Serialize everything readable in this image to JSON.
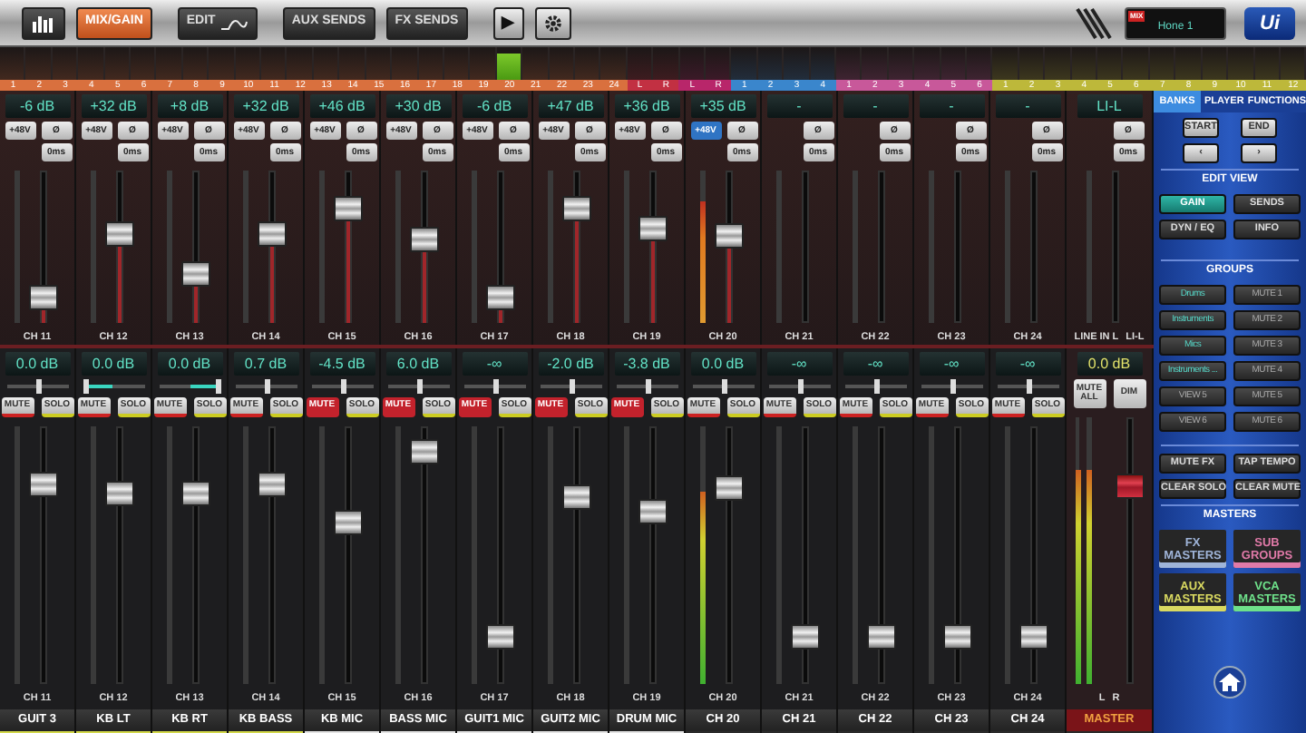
{
  "toolbar": {
    "views": [
      {
        "kind": "meters",
        "selected": false
      },
      {
        "kind": "text",
        "label": "MIX/GAIN",
        "selected": true
      },
      {
        "kind": "edit",
        "label": "EDIT",
        "selected": false
      },
      {
        "kind": "text",
        "label": "AUX SENDS",
        "selected": false
      },
      {
        "kind": "text",
        "label": "FX SENDS",
        "selected": false
      }
    ],
    "play_symbol": "▶",
    "mix_tag": "MIX",
    "mix_select": "Hone 1",
    "logo": "Ui"
  },
  "bank_ruler": [
    {
      "color": "#d9703e",
      "labels": [
        "1",
        "2",
        "3",
        "4",
        "5",
        "6",
        "7",
        "8",
        "9",
        "10",
        "11",
        "12",
        "13",
        "14",
        "15",
        "16",
        "17",
        "18",
        "19",
        "20",
        "21",
        "22",
        "23",
        "24"
      ]
    },
    {
      "color": "#c23042",
      "labels": [
        "L",
        "R"
      ]
    },
    {
      "color": "#b8266a",
      "labels": [
        "L",
        "R"
      ]
    },
    {
      "color": "#3a86cc",
      "labels": [
        "1",
        "2",
        "3",
        "4"
      ]
    },
    {
      "color": "#c8589a",
      "labels": [
        "1",
        "2",
        "3",
        "4",
        "5",
        "6"
      ]
    },
    {
      "color": "#bdb83a",
      "labels": [
        "1",
        "2",
        "3",
        "4",
        "5",
        "6",
        "7",
        "8",
        "9",
        "10",
        "11",
        "12"
      ]
    }
  ],
  "channels": [
    {
      "label": "CH 11",
      "gain": "-6 dB",
      "phantom": {
        "label": "+48V",
        "on": false
      },
      "phase": "Ø",
      "delay": "0ms",
      "gain_fader": {
        "level": 0.1
      },
      "level_display": "0.0 dB",
      "pan": {
        "level": 0.5
      },
      "mute": {
        "label": "MUTE",
        "on": false
      },
      "solo": "SOLO",
      "fader": {
        "level": 0.82
      },
      "lower_label": "CH 11",
      "name": "GUIT 3",
      "color": "#d2d84a"
    },
    {
      "label": "CH 12",
      "gain": "+32 dB",
      "phantom": {
        "label": "+48V",
        "on": false
      },
      "phase": "Ø",
      "delay": "0ms",
      "gain_fader": {
        "level": 0.62
      },
      "level_display": "0.0 dB",
      "pan": {
        "level": 0.05
      },
      "mute": {
        "label": "MUTE",
        "on": false
      },
      "solo": "SOLO",
      "fader": {
        "level": 0.78
      },
      "lower_label": "CH 12",
      "name": "KB LT",
      "color": "#d2d84a"
    },
    {
      "label": "CH 13",
      "gain": "+8 dB",
      "phantom": {
        "label": "+48V",
        "on": false
      },
      "phase": "Ø",
      "delay": "0ms",
      "gain_fader": {
        "level": 0.3
      },
      "level_display": "0.0 dB",
      "pan": {
        "level": 0.95
      },
      "mute": {
        "label": "MUTE",
        "on": false
      },
      "solo": "SOLO",
      "fader": {
        "level": 0.78
      },
      "lower_label": "CH 13",
      "name": "KB RT",
      "color": "#d2d84a"
    },
    {
      "label": "CH 14",
      "gain": "+32 dB",
      "phantom": {
        "label": "+48V",
        "on": false
      },
      "phase": "Ø",
      "delay": "0ms",
      "gain_fader": {
        "level": 0.62
      },
      "level_display": "0.7 dB",
      "pan": {
        "level": 0.5
      },
      "mute": {
        "label": "MUTE",
        "on": false
      },
      "solo": "SOLO",
      "fader": {
        "level": 0.82
      },
      "lower_label": "CH 14",
      "name": "KB BASS",
      "color": "#d2d84a"
    },
    {
      "label": "CH 15",
      "gain": "+46 dB",
      "phantom": {
        "label": "+48V",
        "on": false
      },
      "phase": "Ø",
      "delay": "0ms",
      "gain_fader": {
        "level": 0.82
      },
      "level_display": "-4.5 dB",
      "pan": {
        "level": 0.5
      },
      "mute": {
        "label": "MUTE",
        "on": true
      },
      "solo": "SOLO",
      "fader": {
        "level": 0.65
      },
      "lower_label": "CH 15",
      "name": "KB MIC",
      "color": "#e4e4e4"
    },
    {
      "label": "CH 16",
      "gain": "+30 dB",
      "phantom": {
        "label": "+48V",
        "on": false
      },
      "phase": "Ø",
      "delay": "0ms",
      "gain_fader": {
        "level": 0.58
      },
      "level_display": "6.0 dB",
      "pan": {
        "level": 0.5
      },
      "mute": {
        "label": "MUTE",
        "on": true
      },
      "solo": "SOLO",
      "fader": {
        "level": 0.96
      },
      "lower_label": "CH 16",
      "name": "BASS MIC",
      "color": "#e4e4e4"
    },
    {
      "label": "CH 17",
      "gain": "-6 dB",
      "phantom": {
        "label": "+48V",
        "on": false
      },
      "phase": "Ø",
      "delay": "0ms",
      "gain_fader": {
        "level": 0.1
      },
      "level_display": "-∞",
      "pan": {
        "level": 0.5
      },
      "mute": {
        "label": "MUTE",
        "on": true
      },
      "solo": "SOLO",
      "fader": {
        "level": 0.15
      },
      "lower_label": "CH 17",
      "name": "GUIT1 MIC",
      "color": "#e4e4e4"
    },
    {
      "label": "CH 18",
      "gain": "+47 dB",
      "phantom": {
        "label": "+48V",
        "on": false
      },
      "phase": "Ø",
      "delay": "0ms",
      "gain_fader": {
        "level": 0.82
      },
      "level_display": "-2.0 dB",
      "pan": {
        "level": 0.5
      },
      "mute": {
        "label": "MUTE",
        "on": true
      },
      "solo": "SOLO",
      "fader": {
        "level": 0.76
      },
      "lower_label": "CH 18",
      "name": "GUIT2 MIC",
      "color": "#e4e4e4"
    },
    {
      "label": "CH 19",
      "gain": "+36 dB",
      "phantom": {
        "label": "+48V",
        "on": false
      },
      "phase": "Ø",
      "delay": "0ms",
      "gain_fader": {
        "level": 0.66
      },
      "level_display": "-3.8 dB",
      "pan": {
        "level": 0.5
      },
      "mute": {
        "label": "MUTE",
        "on": true
      },
      "solo": "SOLO",
      "fader": {
        "level": 0.7
      },
      "lower_label": "CH 19",
      "name": "DRUM MIC",
      "color": "#e4e4e4"
    },
    {
      "label": "CH 20",
      "gain": "+35 dB",
      "phantom": {
        "label": "+48V",
        "on": true
      },
      "phase": "Ø",
      "delay": "0ms",
      "gain_fader": {
        "level": 0.6
      },
      "meter": {
        "level": 0.8
      },
      "level_display": "0.0 dB",
      "pan": {
        "level": 0.5
      },
      "mute": {
        "label": "MUTE",
        "on": false
      },
      "solo": "SOLO",
      "fader": {
        "level": 0.8
      },
      "lower_meter": {
        "level": 0.75
      },
      "lower_label": "CH 20",
      "name": "CH 20"
    },
    {
      "label": "CH 21",
      "gain": "-",
      "phase": "Ø",
      "delay": "0ms",
      "level_display": "-∞",
      "pan": {
        "level": 0.5
      },
      "mute": {
        "label": "MUTE",
        "on": false
      },
      "solo": "SOLO",
      "fader": {
        "level": 0.15
      },
      "lower_label": "CH 21",
      "name": "CH 21"
    },
    {
      "label": "CH 22",
      "gain": "-",
      "phase": "Ø",
      "delay": "0ms",
      "level_display": "-∞",
      "pan": {
        "level": 0.5
      },
      "mute": {
        "label": "MUTE",
        "on": false
      },
      "solo": "SOLO",
      "fader": {
        "level": 0.15
      },
      "lower_label": "CH 22",
      "name": "CH 22"
    },
    {
      "label": "CH 23",
      "gain": "-",
      "phase": "Ø",
      "delay": "0ms",
      "level_display": "-∞",
      "pan": {
        "level": 0.5
      },
      "mute": {
        "label": "MUTE",
        "on": false
      },
      "solo": "SOLO",
      "fader": {
        "level": 0.15
      },
      "lower_label": "CH 23",
      "name": "CH 23"
    },
    {
      "label": "CH 24",
      "gain": "-",
      "phase": "Ø",
      "delay": "0ms",
      "level_display": "-∞",
      "pan": {
        "level": 0.5
      },
      "mute": {
        "label": "MUTE",
        "on": false
      },
      "solo": "SOLO",
      "fader": {
        "level": 0.15
      },
      "lower_label": "CH 24",
      "name": "CH 24"
    }
  ],
  "line_in": {
    "gain": "LI-L",
    "phase": "Ø",
    "delay": "0ms",
    "label": "LINE IN L",
    "sublabel": "LI-L"
  },
  "master": {
    "level_display": "0.0 dB",
    "mute_all": "MUTE ALL",
    "dim": "DIM",
    "meter_left": {
      "level": 0.8
    },
    "meter_right": {
      "level": 0.8
    },
    "fader": {
      "level": 0.78
    },
    "label_left": "L",
    "label_right": "R",
    "name": "MASTER"
  },
  "panel": {
    "tabs": [
      {
        "label": "BANKS",
        "selected": true
      },
      {
        "label": "PLAYER",
        "selected": false
      },
      {
        "label": "FUNCTIONS",
        "selected": false
      }
    ],
    "start": "START",
    "end": "END",
    "prev": "‹",
    "next": "›",
    "edit_view_title": "EDIT VIEW",
    "edit_views": [
      {
        "label": "GAIN",
        "selected": true
      },
      {
        "label": "SENDS",
        "selected": false
      },
      {
        "label": "DYN / EQ",
        "selected": false
      },
      {
        "label": "INFO",
        "selected": false
      }
    ],
    "groups_title": "GROUPS",
    "groups": [
      {
        "view": "Drums",
        "assigned": true,
        "mute": "MUTE 1"
      },
      {
        "view": "Instruments",
        "assigned": true,
        "mute": "MUTE 2"
      },
      {
        "view": "Mics",
        "assigned": true,
        "mute": "MUTE 3"
      },
      {
        "view": "Instruments ...",
        "assigned": true,
        "mute": "MUTE 4"
      },
      {
        "view": "VIEW 5",
        "assigned": false,
        "mute": "MUTE 5"
      },
      {
        "view": "VIEW 6",
        "assigned": false,
        "mute": "MUTE 6"
      }
    ],
    "functions": [
      "MUTE FX",
      "TAP TEMPO",
      "CLEAR SOLO",
      "CLEAR MUTE"
    ],
    "masters_title": "MASTERS",
    "masters": [
      {
        "label": "FX MASTERS",
        "color": "#9fb4d8"
      },
      {
        "label": "SUB GROUPS",
        "color": "#e07aa8"
      },
      {
        "label": "AUX MASTERS",
        "color": "#d8d860"
      },
      {
        "label": "VCA MASTERS",
        "color": "#6ee08a"
      }
    ]
  }
}
